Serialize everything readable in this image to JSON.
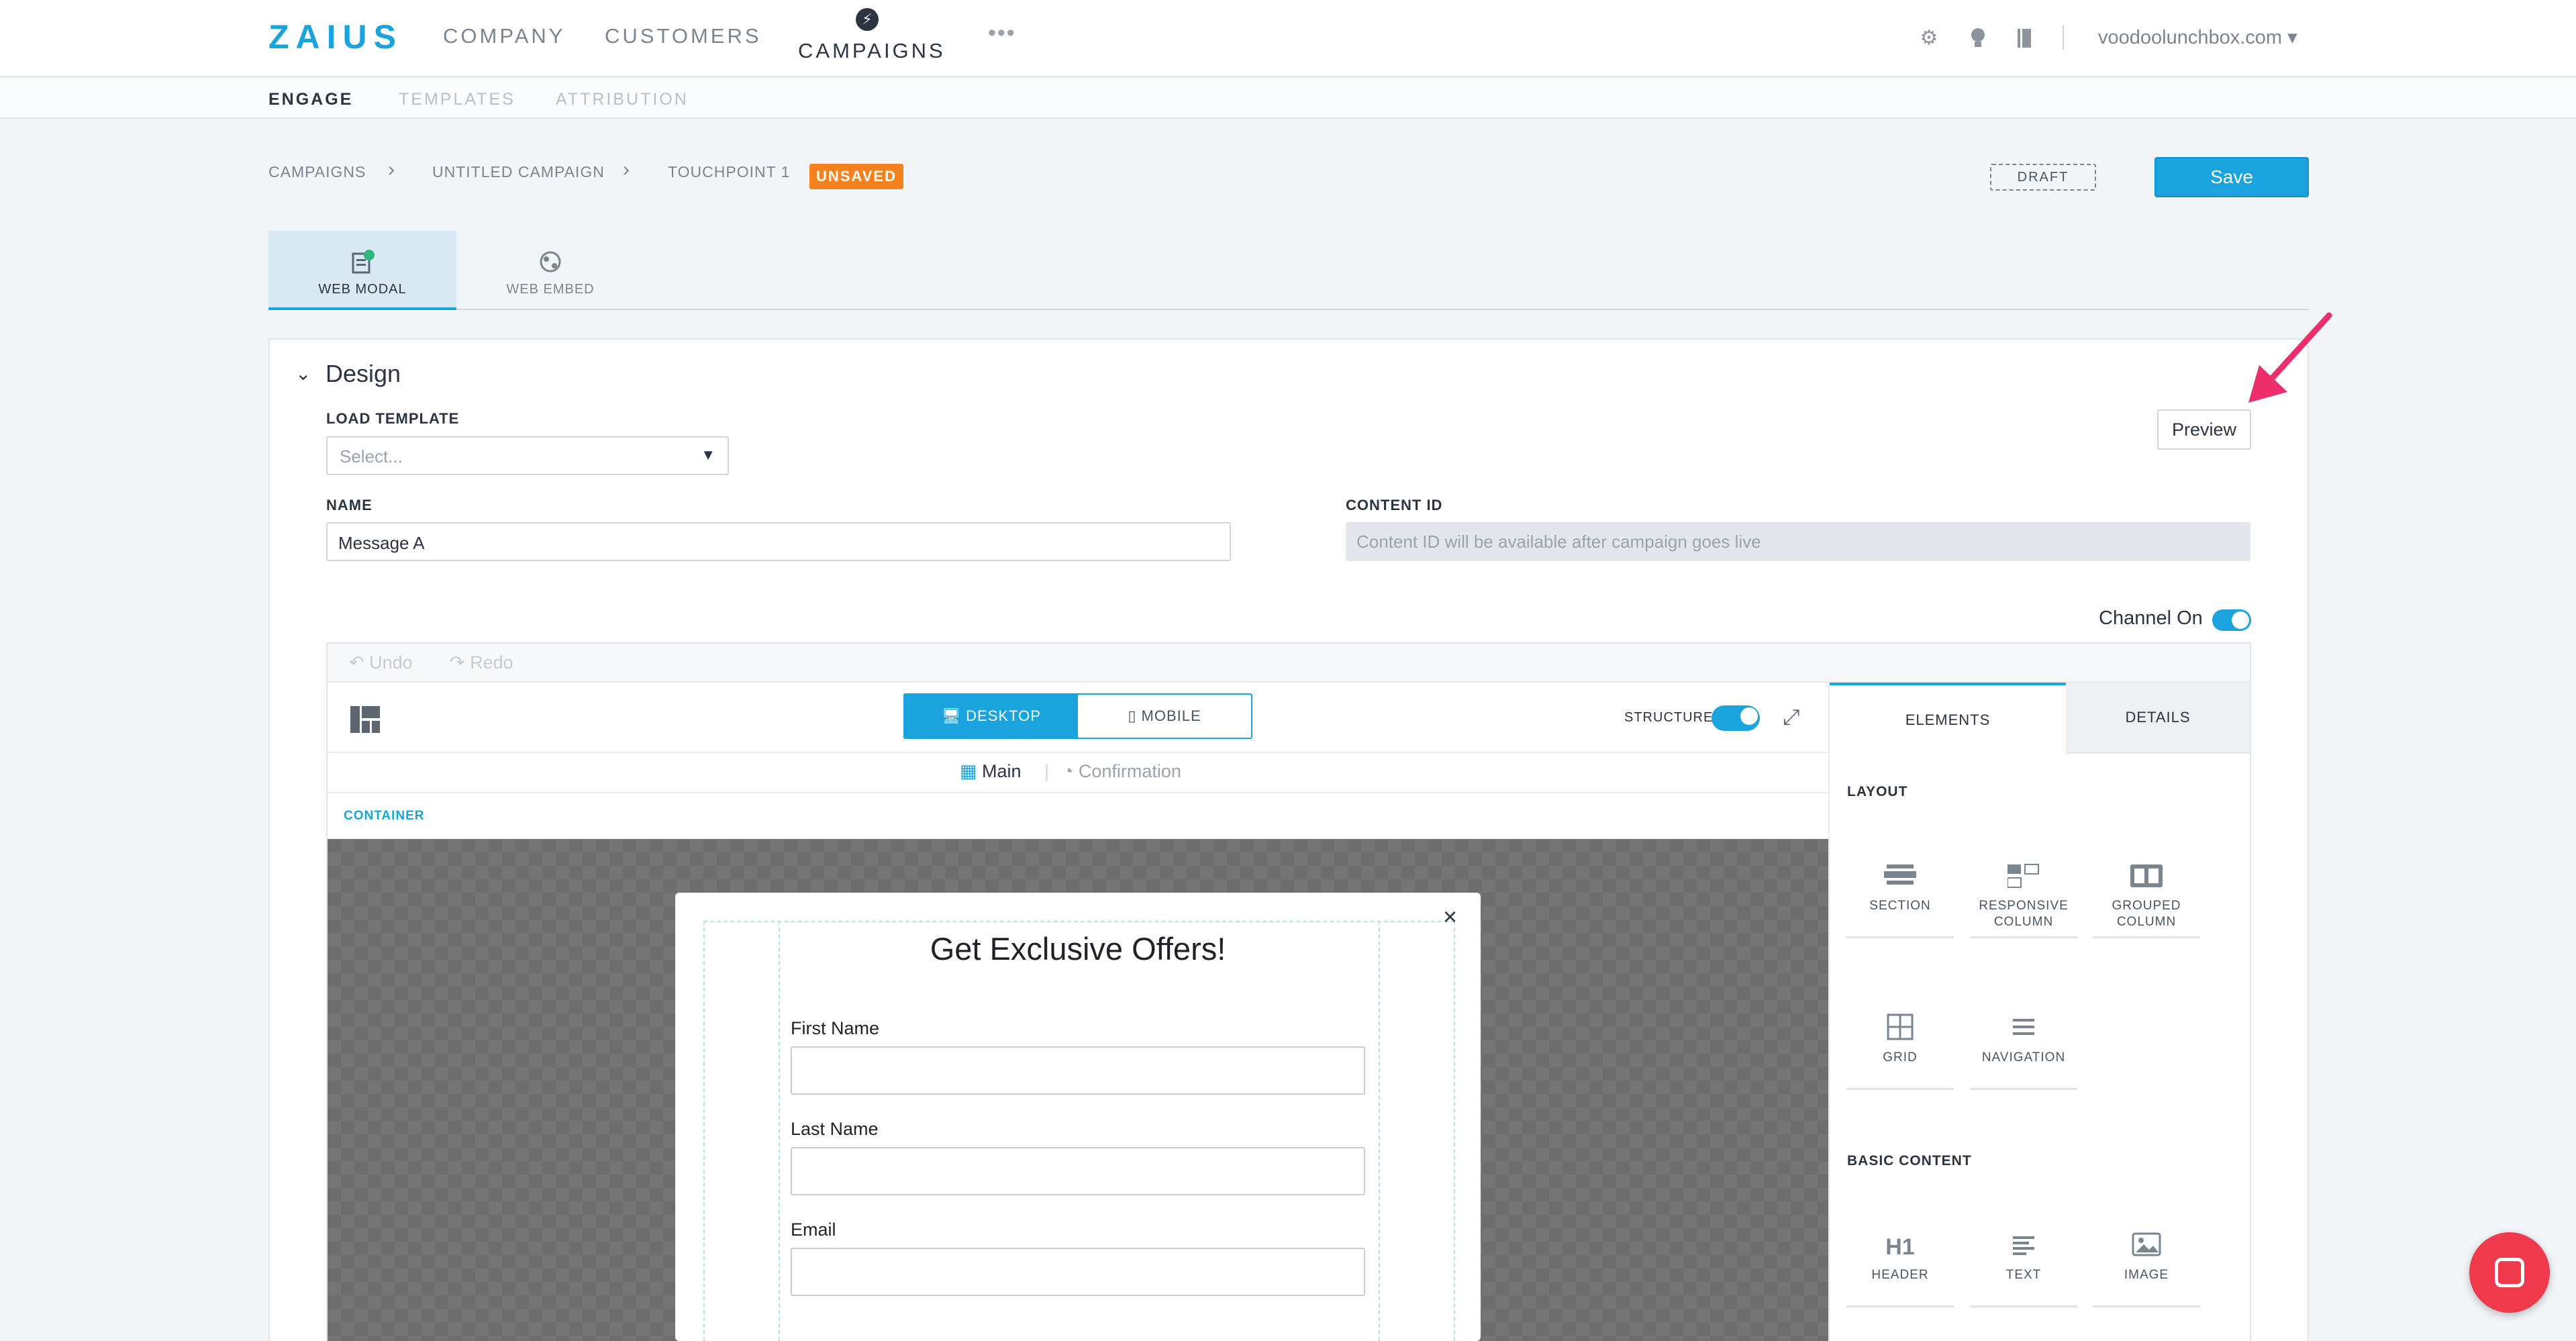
{
  "topnav": {
    "logo": "ZAIUS",
    "items": [
      "COMPANY",
      "CUSTOMERS",
      "CAMPAIGNS"
    ],
    "more": "•••",
    "account": "voodoolunchbox.com ▾",
    "icons": [
      "gear-icon",
      "lightbulb-icon",
      "book-icon"
    ]
  },
  "subnav": {
    "items": [
      "ENGAGE",
      "TEMPLATES",
      "ATTRIBUTION"
    ]
  },
  "breadcrumb": {
    "items": [
      "CAMPAIGNS",
      "UNTITLED CAMPAIGN",
      "TOUCHPOINT 1"
    ],
    "badge": "UNSAVED"
  },
  "status": {
    "draft": "DRAFT",
    "save_label": "Save"
  },
  "channel_tabs": [
    {
      "label": "WEB MODAL"
    },
    {
      "label": "WEB EMBED"
    }
  ],
  "design": {
    "title": "Design",
    "load_template_label": "LOAD TEMPLATE",
    "load_template_placeholder": "Select...",
    "name_label": "NAME",
    "name_value": "Message A",
    "content_id_label": "CONTENT ID",
    "content_id_placeholder": "Content ID will be available after campaign goes live",
    "preview_label": "Preview",
    "channel_on_label": "Channel On"
  },
  "editor": {
    "undo": "Undo",
    "redo": "Redo",
    "devices": [
      "DESKTOP",
      "MOBILE"
    ],
    "structure_label": "STRUCTURE",
    "views": [
      "Main",
      "Confirmation"
    ],
    "container_label": "CONTAINER",
    "modal": {
      "title": "Get Exclusive Offers!",
      "close": "×",
      "fields": [
        "First Name",
        "Last Name",
        "Email"
      ]
    }
  },
  "panel": {
    "tabs": [
      "ELEMENTS",
      "DETAILS"
    ],
    "layout_heading": "LAYOUT",
    "layout_items": [
      {
        "label": "SECTION"
      },
      {
        "label": "RESPONSIVE\nCOLUMN"
      },
      {
        "label": "GROUPED\nCOLUMN"
      },
      {
        "label": "GRID"
      },
      {
        "label": "NAVIGATION"
      }
    ],
    "basic_heading": "BASIC CONTENT",
    "basic_items": [
      {
        "label": "HEADER",
        "glyph": "H1"
      },
      {
        "label": "TEXT"
      },
      {
        "label": "IMAGE"
      }
    ]
  },
  "colors": {
    "accent": "#1aa3dd",
    "unsaved": "#f5821f",
    "annotation_arrow": "#ee2d6b",
    "chat": "#ee3a4b"
  }
}
